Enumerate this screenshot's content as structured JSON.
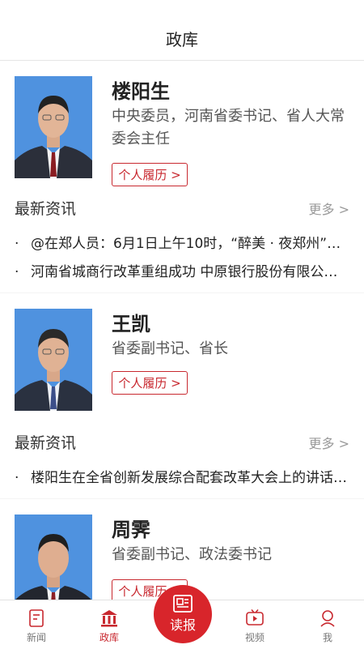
{
  "header": {
    "title": "政库"
  },
  "officials": [
    {
      "name": "楼阳生",
      "title": "中央委员，河南省委书记、省人大常委会主任",
      "resume_label": "个人履历 >",
      "news_heading": "最新资讯",
      "more_label": "更多 >",
      "news": [
        "@在郑人员：6月1日上午10时，“醉美 · 夜郑州”……",
        "河南省城商行改革重组成功 中原银行股份有限公司……"
      ]
    },
    {
      "name": "王凯",
      "title": "省委副书记、省长",
      "resume_label": "个人履历 >",
      "news_heading": "最新资讯",
      "more_label": "更多 >",
      "news": [
        "楼阳生在全省创新发展综合配套改革大会上的讲话……"
      ]
    },
    {
      "name": "周霁",
      "title": "省委副书记、政法委书记",
      "resume_label": "个人履历 >"
    }
  ],
  "tabbar": {
    "tabs": [
      {
        "label": "新闻",
        "icon": "news-icon"
      },
      {
        "label": "政库",
        "icon": "library-icon",
        "active": true
      },
      {
        "label": "读报",
        "icon": "newspaper-icon"
      },
      {
        "label": "视频",
        "icon": "video-icon"
      },
      {
        "label": "我",
        "icon": "user-icon"
      }
    ],
    "accent": "#d8252b"
  }
}
